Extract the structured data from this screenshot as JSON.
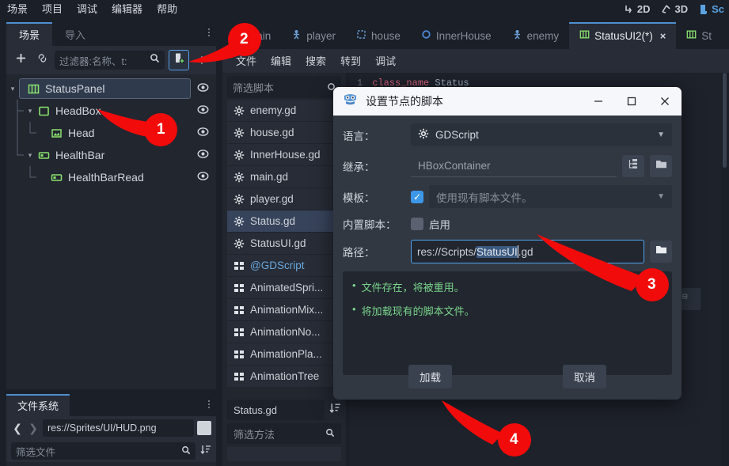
{
  "menubar": {
    "items": [
      "场景",
      "项目",
      "调试",
      "编辑器",
      "帮助"
    ]
  },
  "viewmodes": [
    {
      "label": "2D",
      "icon": "2d-icon",
      "active": false
    },
    {
      "label": "3D",
      "icon": "3d-icon",
      "active": false
    },
    {
      "label": "Sc",
      "icon": "script-icon",
      "active": true
    }
  ],
  "scene_dock": {
    "tabs": [
      {
        "label": "场景",
        "active": true
      },
      {
        "label": "导入",
        "active": false
      }
    ],
    "toolbar": {
      "add_icon": "plus-icon",
      "link_icon": "link-icon",
      "filter_placeholder": "过滤器:名称、t:",
      "search_icon": "search-icon",
      "attach_script_icon": "attach-script-icon",
      "more_icon": "more-vertical-icon"
    },
    "tree": [
      {
        "label": "StatusPanel",
        "depth": 0,
        "icon": "hboxcontainer-icon",
        "selected": true,
        "expanded": true
      },
      {
        "label": "HeadBox",
        "depth": 1,
        "icon": "panel-icon",
        "selected": false,
        "expanded": true
      },
      {
        "label": "Head",
        "depth": 2,
        "icon": "texturerect-icon",
        "selected": false,
        "expanded": false
      },
      {
        "label": "HealthBar",
        "depth": 1,
        "icon": "progressbar-icon",
        "selected": false,
        "expanded": true
      },
      {
        "label": "HealthBarRead",
        "depth": 2,
        "icon": "progressbar-icon",
        "selected": false,
        "expanded": false
      }
    ]
  },
  "filesystem_dock": {
    "tab": "文件系统",
    "more_icon": "more-vertical-icon",
    "back_icon": "chevron-left-icon",
    "forward_icon": "chevron-right-icon",
    "path_value": "res://Sprites/UI/HUD.png",
    "filter_placeholder": "筛选文件",
    "search_icon": "search-icon",
    "sort_icon": "sort-icon"
  },
  "script_tabs": [
    {
      "label": "main",
      "icon": "node2d-icon",
      "active": false
    },
    {
      "label": "player",
      "icon": "character-icon",
      "active": false
    },
    {
      "label": "house",
      "icon": "area-icon",
      "active": false
    },
    {
      "label": "InnerHouse",
      "icon": "circle-icon",
      "active": false
    },
    {
      "label": "enemy",
      "icon": "character-icon",
      "active": false
    },
    {
      "label": "StatusUI2(*)",
      "icon": "hboxcontainer-icon",
      "active": true,
      "close": "×"
    },
    {
      "label": "St",
      "icon": "hboxcontainer-icon",
      "active": false
    }
  ],
  "script_menubar": {
    "items": [
      "文件",
      "编辑",
      "搜索",
      "转到",
      "调试"
    ]
  },
  "script_list": {
    "filter_placeholder": "筛选脚本",
    "circle_icon": "circle-icon",
    "items": [
      {
        "label": "enemy.gd",
        "icon": "gdscript-icon",
        "selected": false,
        "kind": "script"
      },
      {
        "label": "house.gd",
        "icon": "gdscript-icon",
        "selected": false,
        "kind": "script"
      },
      {
        "label": "InnerHouse.gd",
        "icon": "gdscript-icon",
        "selected": false,
        "kind": "script"
      },
      {
        "label": "main.gd",
        "icon": "gdscript-icon",
        "selected": false,
        "kind": "script"
      },
      {
        "label": "player.gd",
        "icon": "gdscript-icon",
        "selected": false,
        "kind": "script"
      },
      {
        "label": "Status.gd",
        "icon": "gdscript-icon",
        "selected": true,
        "kind": "script"
      },
      {
        "label": "StatusUI.gd",
        "icon": "gdscript-icon",
        "selected": false,
        "kind": "script"
      },
      {
        "label": "@GDScript",
        "icon": "docs-icon",
        "selected": false,
        "kind": "doc"
      },
      {
        "label": "AnimatedSpri...",
        "icon": "docs-icon",
        "selected": false,
        "kind": "doc"
      },
      {
        "label": "AnimationMix...",
        "icon": "docs-icon",
        "selected": false,
        "kind": "doc"
      },
      {
        "label": "AnimationNo...",
        "icon": "docs-icon",
        "selected": false,
        "kind": "doc"
      },
      {
        "label": "AnimationPla...",
        "icon": "docs-icon",
        "selected": false,
        "kind": "doc"
      },
      {
        "label": "AnimationTree",
        "icon": "docs-icon",
        "selected": false,
        "kind": "doc"
      }
    ],
    "current_name": "Status.gd",
    "sort_icon": "sort-icon",
    "method_filter_placeholder": "筛选方法",
    "method_search_icon": "search-icon"
  },
  "code_editor": {
    "line_number": "1",
    "keyword": "class_name",
    "class_name": "Status"
  },
  "dialog": {
    "icon": "godot-logo-icon",
    "title": "设置节点的脚本",
    "minimize_icon": "minimize-icon",
    "maximize_icon": "maximize-icon",
    "close_icon": "close-icon",
    "language_label": "语言：",
    "language_value": "GDScript",
    "language_icon": "gear-icon",
    "inherits_label": "继承：",
    "inherits_value": "HBoxContainer",
    "inherits_tree_icon": "tree-icon",
    "inherits_folder_icon": "folder-icon",
    "template_label": "模板：",
    "template_checked": true,
    "template_value": "使用现有脚本文件。",
    "builtin_label": "内置脚本：",
    "builtin_checked": false,
    "builtin_enable_label": "启用",
    "path_label": "路径：",
    "path_prefix": "res://Scripts/",
    "path_selected": "StatusUI",
    "path_suffix": ".gd",
    "path_folder_icon": "folder-icon",
    "status_messages": [
      "文件存在，将被重用。",
      "将加载现有的脚本文件。"
    ],
    "load_button": "加载",
    "cancel_button": "取消"
  },
  "callouts": [
    {
      "number": "1"
    },
    {
      "number": "2"
    },
    {
      "number": "3"
    },
    {
      "number": "4"
    }
  ],
  "colors": {
    "accent": "#4f8fd0",
    "highlight_border": "#52a3ef",
    "node_green": "#8ae26f",
    "success_green": "#7ad48b",
    "callout_red": "#f20b0b",
    "selection_blue": "#3c5a80"
  }
}
